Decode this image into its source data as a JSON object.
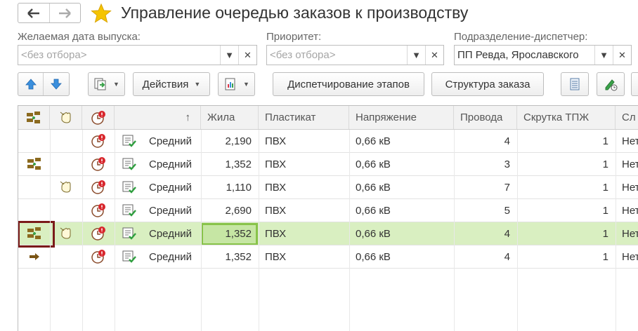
{
  "window": {
    "title": "Управление очередью заказов к производству"
  },
  "filters": [
    {
      "label": "Желаемая дата выпуска:",
      "value": "<без отбора>",
      "is_placeholder": true
    },
    {
      "label": "Приоритет:",
      "value": "<без отбора>",
      "is_placeholder": true
    },
    {
      "label": "Подразделение-диспетчер:",
      "value": "ПП Ревда, Ярославского",
      "is_placeholder": false
    }
  ],
  "toolbar": {
    "actions_label": "Действия",
    "dispatch_label": "Диспетчирование этапов",
    "structure_label": "Структура заказа"
  },
  "table": {
    "sort_indicator": "↑",
    "columns": [
      "Жила",
      "Пластикат",
      "Напряжение",
      "Провода",
      "Скрутка ТПЖ",
      "Сл"
    ],
    "rows": [
      {
        "icon1": "",
        "icon2": "",
        "priority": "Средний",
        "core": "2,190",
        "plastic": "ПВХ",
        "voltage": "0,66 кВ",
        "wires": "4",
        "twist": "1",
        "last": "Нет"
      },
      {
        "icon1": "queue-reorder-icon",
        "icon2": "",
        "priority": "Средний",
        "core": "1,352",
        "plastic": "ПВХ",
        "voltage": "0,66 кВ",
        "wires": "3",
        "twist": "1",
        "last": "Нет"
      },
      {
        "icon1": "",
        "icon2": "hand-stop-icon",
        "priority": "Средний",
        "core": "1,110",
        "plastic": "ПВХ",
        "voltage": "0,66 кВ",
        "wires": "7",
        "twist": "1",
        "last": "Нет"
      },
      {
        "icon1": "",
        "icon2": "",
        "priority": "Средний",
        "core": "2,690",
        "plastic": "ПВХ",
        "voltage": "0,66 кВ",
        "wires": "5",
        "twist": "1",
        "last": "Нет"
      },
      {
        "icon1": "queue-reorder-icon",
        "icon2": "hand-stop-icon",
        "priority": "Средний",
        "core": "1,352",
        "plastic": "ПВХ",
        "voltage": "0,66 кВ",
        "wires": "4",
        "twist": "1",
        "last": "Нет",
        "selected": true
      },
      {
        "icon1": "arrow-right-icon",
        "icon2": "",
        "priority": "Средний",
        "core": "1,352",
        "plastic": "ПВХ",
        "voltage": "0,66 кВ",
        "wires": "4",
        "twist": "1",
        "last": "Нет"
      }
    ]
  },
  "colors": {
    "selected_row": "#d9efc1",
    "focus_border": "#88c34a",
    "icon_focus_border": "#7b1a1a",
    "star": "#f5c400"
  }
}
